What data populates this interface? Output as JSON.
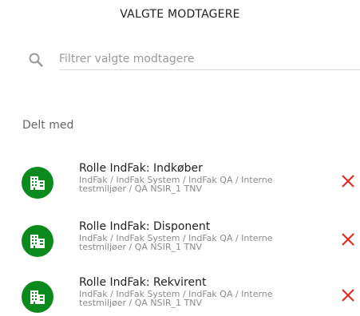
{
  "panel": {
    "title": "VALGTE MODTAGERE"
  },
  "filter": {
    "placeholder": "Filtrer valgte modtagere",
    "value": "",
    "icon": "search-icon"
  },
  "section": {
    "label": "Delt med"
  },
  "colors": {
    "avatar_bg": "#0a8a1c",
    "remove": "#e5261f"
  },
  "recipients": [
    {
      "name": "Rolle IndFak: Indkøber",
      "path": "IndFak / IndFak System / IndFak QA / Interne testmiljøer / QA NSIR_1 TNV",
      "icon": "building-icon",
      "remove_icon": "close-icon"
    },
    {
      "name": "Rolle IndFak: Disponent",
      "path": "IndFak / IndFak System / IndFak QA / Interne testmiljøer / QA NSIR_1 TNV",
      "icon": "building-icon",
      "remove_icon": "close-icon"
    },
    {
      "name": "Rolle IndFak: Rekvirent",
      "path": "IndFak / IndFak System / IndFak QA / Interne testmiljøer / QA NSIR_1 TNV",
      "icon": "building-icon",
      "remove_icon": "close-icon"
    }
  ]
}
